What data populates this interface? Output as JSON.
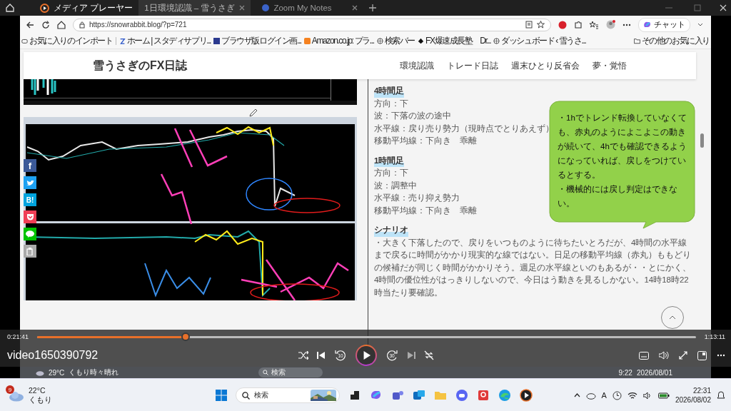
{
  "player": {
    "title": "メディア プレーヤー",
    "video_title": "video1650390792",
    "elapsed": "0:21:41",
    "duration": "1:13:11",
    "progress": {
      "level": 0.225
    },
    "playing": false,
    "skip_back": "10",
    "skip_forward": "30"
  },
  "browser": {
    "tabs": [
      {
        "label": "1日環境認識 – 雪うさぎ",
        "selected": true
      },
      {
        "label": "Zoom My Notes",
        "selected": false
      }
    ],
    "url": "https://snowrabbit.blog/?p=721",
    "chat": "チャット",
    "bookmarks": [
      "お気に入りのインポート",
      "ホーム | スタディサプリ...",
      "ブラウザ版ログイン画...",
      "Amazon.co.jp: プラ...",
      "検索バー",
      "FX爆速成長塾　Dr...",
      "ダッシュボード ‹ 雪うさ..."
    ],
    "other_bookmarks": "その他のお気に入り"
  },
  "site": {
    "title": "雪うさぎのFX日誌",
    "nav": [
      "環境認識",
      "トレード日誌",
      "週末ひとり反省会",
      "夢・覚悟"
    ]
  },
  "share": [
    {
      "kind": "facebook",
      "label": "f"
    },
    {
      "kind": "twitter"
    },
    {
      "kind": "hatena",
      "label": "B!"
    },
    {
      "kind": "pocket"
    },
    {
      "kind": "line"
    },
    {
      "kind": "copy"
    }
  ],
  "article": {
    "sections": [
      {
        "heading": "4時間足",
        "lines": [
          "方向：下",
          "波：下落の波の途中",
          "水平線：戻り売り勢力（現時点でとりあえず）",
          "移動平均線：下向き　乖離"
        ]
      },
      {
        "heading": "1時間足",
        "lines": [
          "方向：下",
          "波：調整中",
          "水平線：売り抑え勢力",
          "移動平均線：下向き　乖離"
        ]
      },
      {
        "heading": "シナリオ",
        "paragraph": "・大きく下落したので、戻りをいつものように待ちたいとろだが、4時間の水平線まで戻るに時間がかかり現実的な線ではない。日足の移動平均線（赤丸）ももどりの候補だが同じく時間がかかりそう。週足の水平線といのもあるが・・とにかく、4時間の優位性がはっきりしないので、今日はう動きを見るしかない。14時18時22時当たり要確認。"
      }
    ],
    "callout": [
      "・1hでトレンド転換していなくても、赤丸のようによこよこの動きが続いて、4hでも確認できるようになっていれば、戻しをつけているとする。",
      "・機械的には戻し判定はできない。"
    ]
  },
  "recorded_taskbar": {
    "temperature": "29°C",
    "weather": "くもり時々晴れ",
    "search": "検索",
    "time": "9:22",
    "date": "2026/08/01"
  },
  "taskbar": {
    "notifications": "9",
    "temperature": "22°C",
    "weather": "くもり",
    "search": "検索",
    "ime": "A",
    "time": "22:31",
    "date": "2026/08/02"
  }
}
